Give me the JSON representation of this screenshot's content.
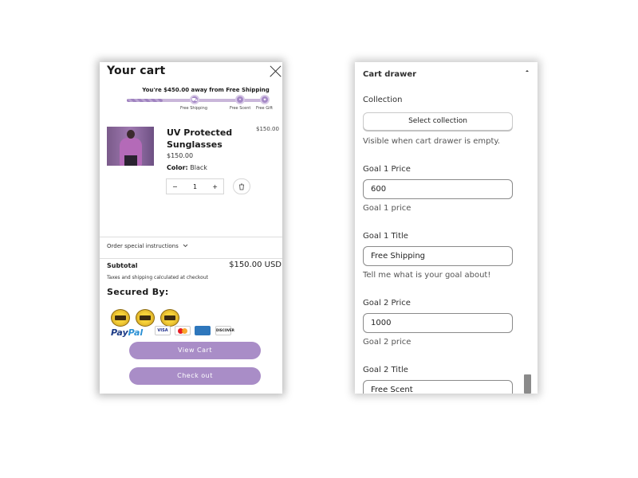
{
  "cart": {
    "title": "Your cart",
    "shipping_message": "You're $450.00 away from Free Shipping",
    "progress": 0.25,
    "goals": [
      "Free Shipping",
      "Free Scent",
      "Free Gift"
    ],
    "product": {
      "name": "UV Protected Sunglasses",
      "line_price": "$150.00",
      "price": "$150.00",
      "color_label": "Color:",
      "color_value": "Black",
      "quantity": "1",
      "minus": "−",
      "plus": "+"
    },
    "instructions_label": "Order special instructions",
    "subtotal_label": "Subtotal",
    "subtotal_value": "$150.00 USD",
    "tax_note": "Taxes and shipping calculated at checkout",
    "secured_by": "Secured By:",
    "payment_logos": [
      "PayPal",
      "VISA",
      "Mastercard",
      "American Express",
      "Discover"
    ],
    "paypal_a": "Pay",
    "paypal_b": "Pal",
    "visa": "VISA",
    "discover": "DISCOVER",
    "view_cart": "View Cart",
    "checkout": "Check out",
    "accent_color": "#a98dc7"
  },
  "settings": {
    "title": "Cart drawer",
    "collection_label": "Collection",
    "select_collection": "Select collection",
    "collection_help": "Visible when cart drawer is empty.",
    "goal1_price_label": "Goal 1 Price",
    "goal1_price_value": "600",
    "goal1_price_help": "Goal 1 price",
    "goal1_title_label": "Goal 1 Title",
    "goal1_title_value": "Free Shipping",
    "goal1_title_help": "Tell me what is your goal about!",
    "goal2_price_label": "Goal 2 Price",
    "goal2_price_value": "1000",
    "goal2_price_help": "Goal 2 price",
    "goal2_title_label": "Goal 2 Title",
    "goal2_title_value": "Free Scent"
  }
}
